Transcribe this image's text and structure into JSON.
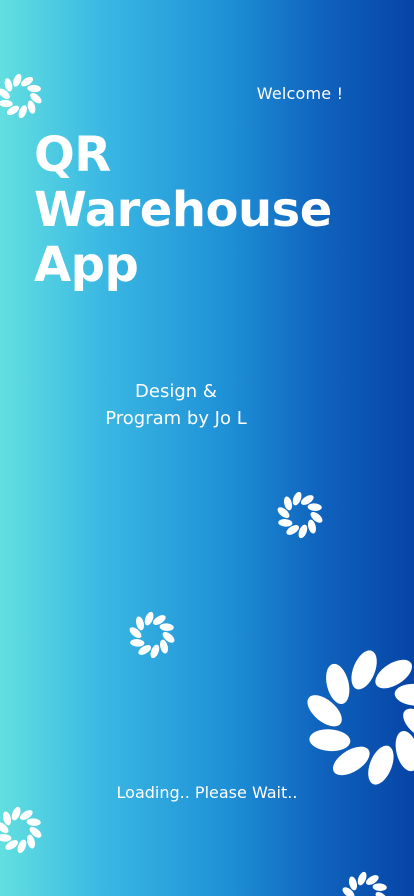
{
  "header": {
    "welcome": "Welcome !"
  },
  "title": {
    "line1": "QR",
    "line2": "Warehouse",
    "line3": "App"
  },
  "credits": {
    "line1": "Design &",
    "line2": "Program by Jo L"
  },
  "status": {
    "loading": "Loading.. Please Wait.."
  },
  "icons": {
    "decoration": "leaf-wreath-icon"
  },
  "colors": {
    "gradient_start": "#62dfe0",
    "gradient_end": "#0644a6",
    "text": "#ffffff"
  }
}
